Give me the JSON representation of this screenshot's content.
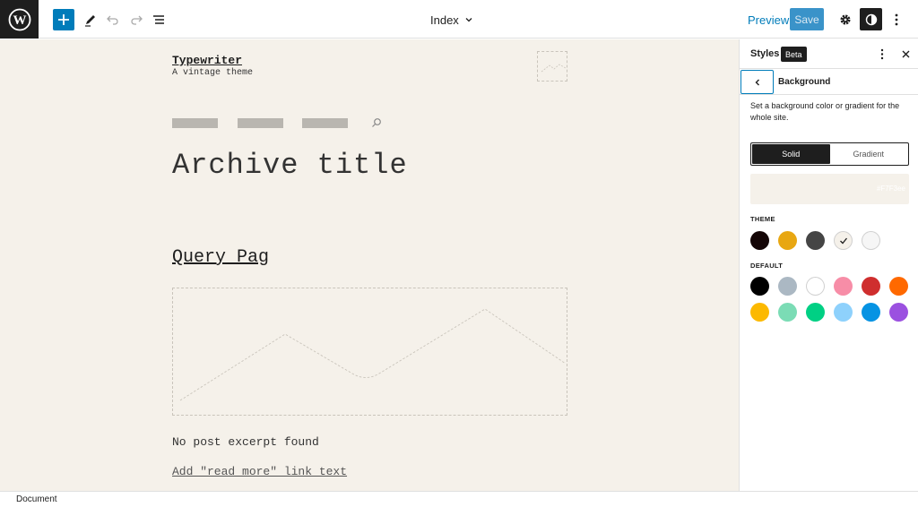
{
  "topbar": {
    "document_title": "Index",
    "preview_label": "Preview",
    "save_label": "Save"
  },
  "canvas": {
    "site_title": "Typewriter",
    "site_tagline": "A vintage theme",
    "archive_title": "Archive title",
    "query_title": "Query Pag",
    "excerpt": "No post excerpt found",
    "read_more": "Add \"read more\" link text",
    "background": "#f5f1ea"
  },
  "sidebar": {
    "title": "Styles",
    "badge": "Beta",
    "section_title": "Background",
    "description": "Set a background color or gradient for the whole site.",
    "tabs": [
      {
        "label": "Solid",
        "active": true
      },
      {
        "label": "Gradient",
        "active": false
      }
    ],
    "current_color_hex": "#F7F3ee",
    "theme_label": "THEME",
    "theme_colors": [
      "#140506",
      "#e8a712",
      "#454545",
      "#f5f1ea",
      "#f6f6f6"
    ],
    "theme_selected": 3,
    "default_label": "DEFAULT",
    "default_colors": [
      "#000000",
      "#abb8c3",
      "#ffffff",
      "#f78da7",
      "#cf2e2e",
      "#ff6900",
      "#fcb900",
      "#7bdcb5",
      "#00d084",
      "#8ed1fc",
      "#0693e3",
      "#9b51e0"
    ]
  },
  "footer": {
    "label": "Document"
  },
  "colors": {
    "accent": "#007cba",
    "dark": "#1e1e1e"
  }
}
